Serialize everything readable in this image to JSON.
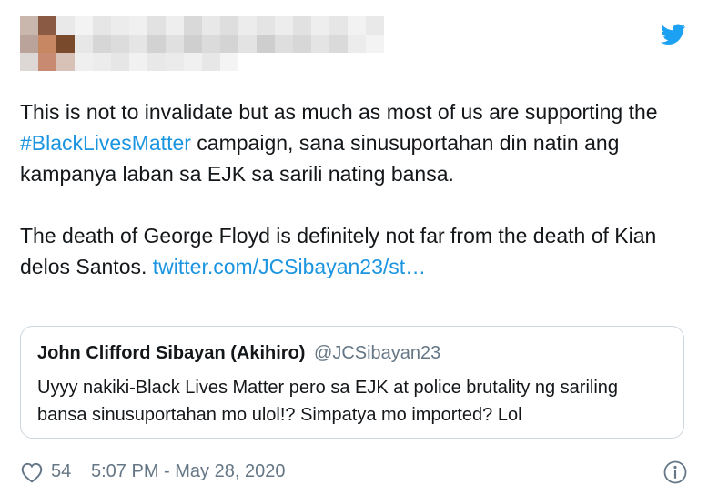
{
  "tweet": {
    "brand_color": "#1da1f2",
    "icons": [
      "heart-icon",
      "info-icon",
      "twitter-bird-icon"
    ],
    "paragraph1": {
      "before": "This is not to invalidate but as much as most of us are supporting the ",
      "hashtag": "#BlackLivesMatter",
      "after": " campaign, sana sinusuportahan din natin ang kampanya laban sa EJK sa sarili nating bansa."
    },
    "paragraph2": {
      "text": "The death of George Floyd is definitely not far from the death of Kian delos Santos. ",
      "link": "twitter.com/JCSibayan23/st…"
    },
    "quoted": {
      "name": "John Clifford Sibayan (Akihiro)",
      "handle": "@JCSibayan23",
      "text": "Uyyy nakiki-Black Lives Matter pero sa EJK at police brutality ng sariling bansa sinusuportahan mo ulol!? Simpatya mo imported? Lol"
    },
    "likes": "54",
    "timestamp": "5:07 PM - May 28, 2020"
  }
}
